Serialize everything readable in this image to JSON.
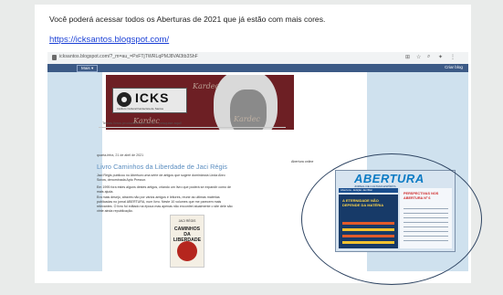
{
  "document": {
    "intro_text": "Você poderá acessar todos os Aberturas de 2021 que já estão com mais cores.",
    "link_text": "https://icksantos.blogspot.com/"
  },
  "browser": {
    "url": "icksantos.blogspot.com/?_m=au_=PxFTjTWRLqPMJ8VAl3tb3ShF",
    "more_label": "Mais ▾",
    "create_label": "Criar blog"
  },
  "blog": {
    "logo_text": "ICKS",
    "logo_subtitle": "Instituto Cultural Kardecista de Santos",
    "signature": "Kardec",
    "tagline": "Temas livros produzidos pelo ICKS - pesquise aqui!",
    "post_date": "quarta-feira, 21 de abril de 2021",
    "post_title": "Livro Caminhos da Liberdade de Jaci Régis",
    "paragraphs": [
      "Jaci Régis publicou no Abertura uma série de artigos que sugere dominância Linda Abro Scrow, denominada Apto Pressor.",
      "Em 1995 fora estes alguns destes artigos, criando um livro que poderá se expandir como de mais ajuda.",
      "Era mais desejo, através não por vários amigos e leitores, reunir as ultimas matérias publicadas no jornal ABERTURA, num livro. Neste 10 volumes que me parecem mais relevantes. O livro foi editado na época mas apenas não encontrei atualmente o site dele são vinte ainda republicação."
    ],
    "book_author": "JACI RÉGIS",
    "book_title": "CAMINHOS DA LIBERDADE",
    "sidebar_label": "Abertura online"
  },
  "magazine": {
    "logo": "ABERTURA",
    "subtitle": "JORNAL DE CULTURA ESPÍRITA",
    "header": "Abertura - Edição Jan/Mar",
    "headline": "A ETERNIDADE NÃO DEPENDE DA MATÉRIA",
    "right_title": "PERSPECTIVAS NOS ABERTURA Nº 6"
  }
}
